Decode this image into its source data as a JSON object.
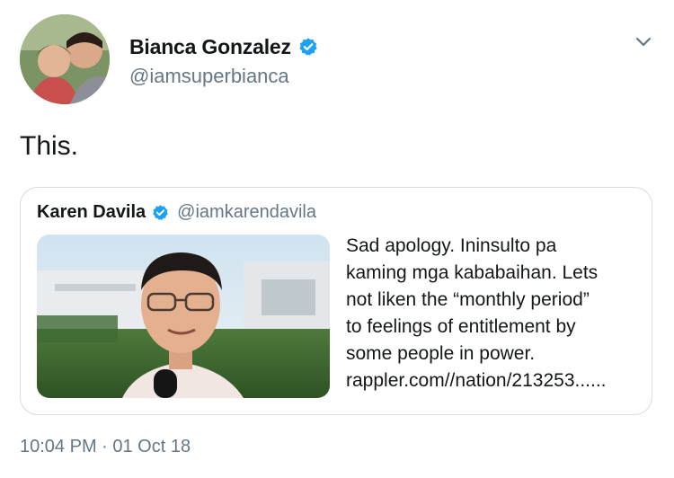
{
  "tweet": {
    "author": {
      "display_name": "Bianca Gonzalez",
      "handle": "@iamsuperbianca",
      "verified": true
    },
    "text": "This.",
    "timestamp": "10:04 PM · 01 Oct 18"
  },
  "quoted_tweet": {
    "author": {
      "display_name": "Karen Davila",
      "handle": "@iamkarendavila",
      "verified": true
    },
    "text_lines": [
      "Sad apology. Ininsulto pa",
      "kaming mga kababaihan. Lets",
      "not liken the “monthly period”",
      "to feelings of entitlement by",
      "some people in power.",
      "rappler.com//nation/213253......"
    ]
  },
  "icons": {
    "verified": "verified-badge-icon",
    "menu": "chevron-down-icon"
  },
  "colors": {
    "verified_blue": "#1da1f2",
    "secondary_text": "#657786",
    "primary_text": "#14171a",
    "card_border": "#d6dde3"
  }
}
